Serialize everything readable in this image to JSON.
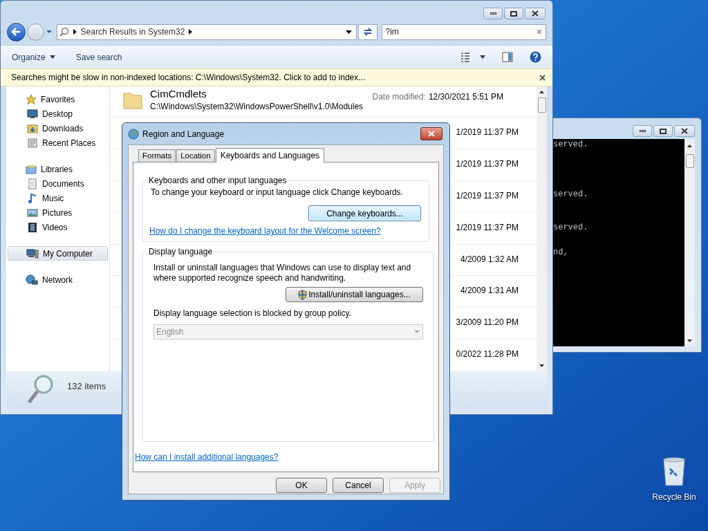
{
  "explorer": {
    "address": {
      "crumbs": [
        "Search Results in System32"
      ]
    },
    "search": {
      "value": "?im"
    },
    "toolbar": [
      "Organize",
      "Save search"
    ],
    "info_bar": "Searches might be slow in non-indexed locations: C:\\Windows\\System32. Click to add to index...",
    "sidebar": [
      {
        "label": "Favorites",
        "selected": false,
        "children": [
          {
            "label": "Desktop",
            "selected": false
          },
          {
            "label": "Downloads",
            "selected": false
          },
          {
            "label": "Recent Places",
            "selected": false
          }
        ]
      },
      {
        "label": "Libraries",
        "selected": false,
        "children": [
          {
            "label": "Documents",
            "selected": false
          },
          {
            "label": "Music",
            "selected": false
          },
          {
            "label": "Pictures",
            "selected": false
          },
          {
            "label": "Videos",
            "selected": false
          }
        ]
      },
      {
        "label": "My Computer",
        "selected": true
      },
      {
        "label": "Network",
        "selected": false
      }
    ],
    "results": [
      {
        "name": "CimCmdlets",
        "path": "C:\\Windows\\System32\\WindowsPowerShell\\v1.0\\Modules",
        "date_label": "Date modified:",
        "date": "12/30/2021 5:51 PM"
      },
      {
        "date": "1/2019 11:37 PM"
      },
      {
        "date": "1/2019 11:37 PM"
      },
      {
        "date": "1/2019 11:37 PM"
      },
      {
        "date": "1/2019 11:37 PM"
      },
      {
        "date": "4/2009 1:32 AM"
      },
      {
        "date": "4/2009 1:31 AM"
      },
      {
        "date": "3/2009 11:20 PM"
      },
      {
        "date": "0/2022 11:28 PM"
      }
    ],
    "status": "132 items"
  },
  "console": {
    "lines": [
      "served.",
      "served.",
      "served.",
      "nd,"
    ]
  },
  "dialog": {
    "title": "Region and Language",
    "tabs": [
      {
        "label": "Formats",
        "selected": false
      },
      {
        "label": "Location",
        "selected": false
      },
      {
        "label": "Keyboards and Languages",
        "selected": true
      }
    ],
    "keyboards": {
      "legend": "Keyboards and other input languages",
      "text": "To change your keyboard or input language click Change keyboards.",
      "button": "Change keyboards...",
      "link": "How do I change the keyboard layout for the Welcome screen?"
    },
    "display": {
      "legend": "Display language",
      "text": "Install or uninstall languages that Windows can use to display text and where supported recognize speech and handwriting.",
      "button": "Install/uninstall languages...",
      "blocked_text": "Display language selection is blocked by group policy.",
      "dropdown": {
        "value": "English",
        "disabled": true
      }
    },
    "link": "How can I install additional languages?",
    "buttons": [
      {
        "label": "OK",
        "disabled": false
      },
      {
        "label": "Cancel",
        "disabled": false
      },
      {
        "label": "Apply",
        "disabled": true
      }
    ]
  },
  "desktop": {
    "icons": [
      {
        "label": "Recycle Bin"
      }
    ]
  }
}
